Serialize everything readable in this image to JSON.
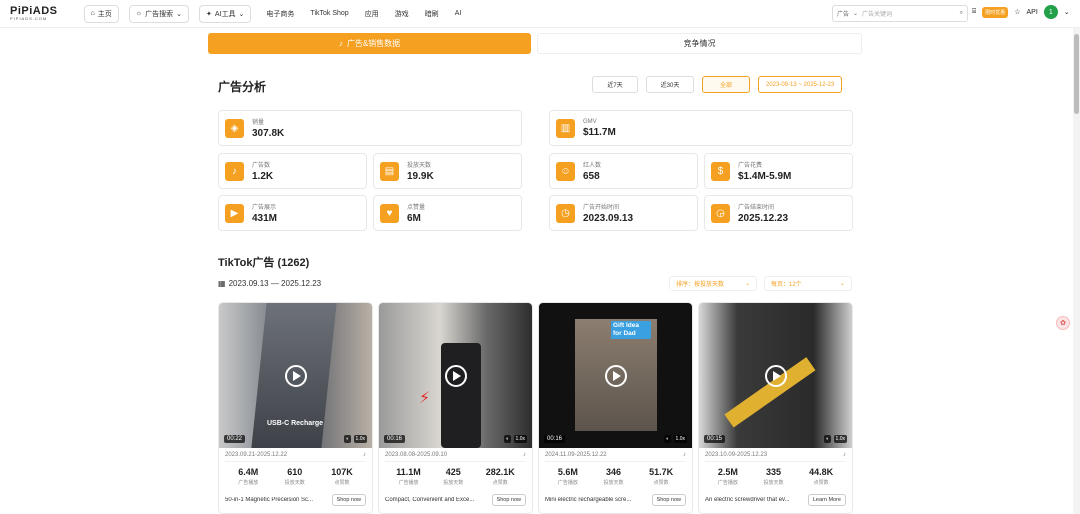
{
  "brand": {
    "logo": "PiPiADS",
    "sub": "PIPIADS.COM"
  },
  "nav": {
    "home": "主页",
    "ad_search": "广告搜索",
    "ai_tools": "AI工具",
    "links": [
      "电子商务",
      "TikTok Shop",
      "应用",
      "游戏",
      "暗刷",
      "AI"
    ]
  },
  "search": {
    "scope": "广告",
    "placeholder": "广告关键词"
  },
  "header_right": {
    "badge": "限时优惠",
    "api": "API",
    "avatar": "1"
  },
  "tabs": {
    "ads_sales": "广告&销售数据",
    "competition": "竞争情况"
  },
  "analysis": {
    "title": "广告分析",
    "date_buttons": [
      "近7天",
      "近30天",
      "全部"
    ],
    "date_range": "2023-09-13 ~ 2025-12-23",
    "metrics": {
      "sales": {
        "label": "销量",
        "value": "307.8K"
      },
      "gmv": {
        "label": "GMV",
        "value": "$11.7M"
      },
      "ad_count": {
        "label": "广告数",
        "value": "1.2K"
      },
      "run_days": {
        "label": "投放天数",
        "value": "19.9K"
      },
      "influencers": {
        "label": "红人数",
        "value": "658"
      },
      "ad_spend": {
        "label": "广告花费",
        "value": "$1.4M-5.9M"
      },
      "impressions": {
        "label": "广告展示",
        "value": "431M"
      },
      "likes": {
        "label": "点赞量",
        "value": "6M"
      },
      "start": {
        "label": "广告开始时间",
        "value": "2023.09.13"
      },
      "end": {
        "label": "广告结束时间",
        "value": "2025.12.23"
      }
    }
  },
  "ads": {
    "title": "TikTok广告 (1262)",
    "range": "2023.09.13 — 2025.12.23",
    "sort": "排序：按投放天数",
    "per_page": "每页：12个",
    "items": [
      {
        "duration": "00:22",
        "overlay": "USB-C Recharge",
        "dates": "2023.09.21-2025.12.22",
        "impr": "6.4M",
        "days": "610",
        "likes": "107K",
        "desc": "50-in-1 Magnetic Preceision Sc...",
        "cta": "Shop now"
      },
      {
        "duration": "00:16",
        "overlay": "",
        "dates": "2023.08.08-2025.09.10",
        "impr": "11.1M",
        "days": "425",
        "likes": "282.1K",
        "desc": "Compact, Convenient and Exce...",
        "cta": "Shop now"
      },
      {
        "duration": "00:16",
        "overlay": "Gift Idea for Dad",
        "dates": "2024.11.09-2025.12.22",
        "impr": "5.6M",
        "days": "346",
        "likes": "51.7K",
        "desc": "Mini electric rechargeable scre...",
        "cta": "Shop now"
      },
      {
        "duration": "00:15",
        "overlay": "",
        "dates": "2023.10.09-2025.12.23",
        "impr": "2.5M",
        "days": "335",
        "likes": "44.8K",
        "desc": "An electric screwdriver that ev...",
        "cta": "Learn More"
      }
    ],
    "stat_labels": {
      "impr": "广告播放",
      "days": "投放天数",
      "likes": "点赞数"
    },
    "speed": "1.0x"
  }
}
